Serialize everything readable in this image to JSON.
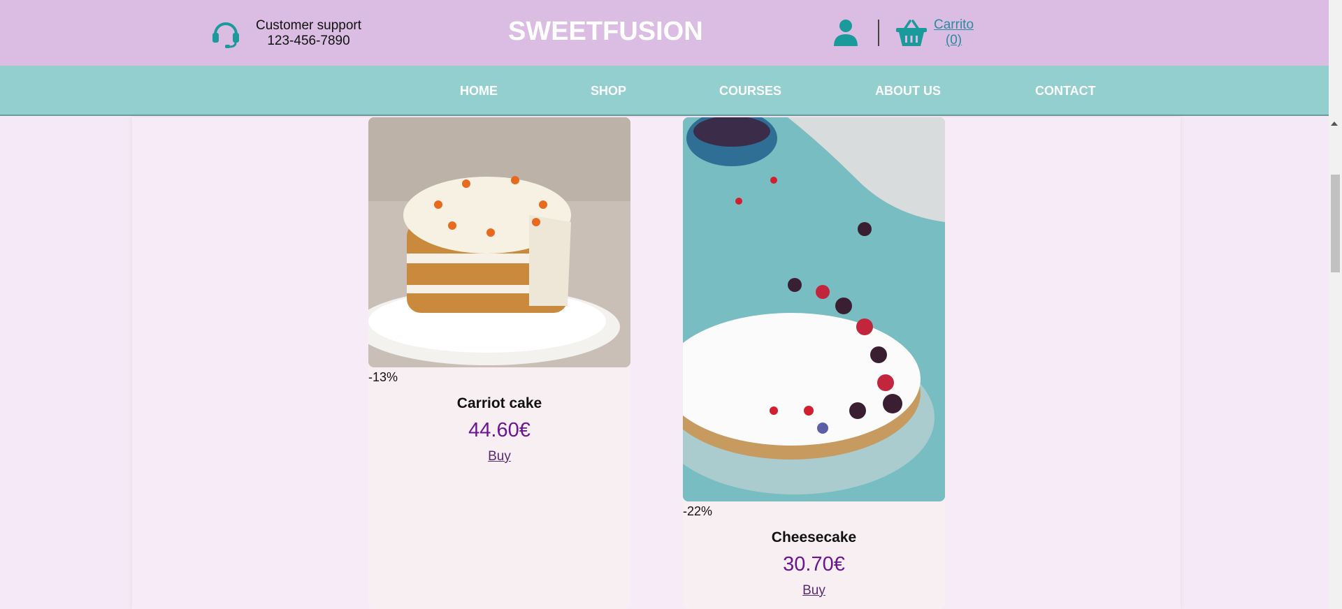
{
  "header": {
    "support_label": "Customer support",
    "support_phone": "123-456-7890",
    "brand": "SWEETFUSION",
    "cart_label": "Carrito",
    "cart_count": "(0)"
  },
  "nav": {
    "items": [
      "HOME",
      "SHOP",
      "COURSES",
      "ABOUT US",
      "CONTACT"
    ]
  },
  "products": [
    {
      "discount": "-13%",
      "name": "Carriot cake",
      "price": "44.60€",
      "buy_label": "Buy"
    },
    {
      "discount": "-22%",
      "name": "Cheesecake",
      "price": "30.70€",
      "buy_label": "Buy"
    }
  ],
  "colors": {
    "header_bg": "#dbbde3",
    "nav_bg": "#93cfcf",
    "accent_teal": "#1a9a9a",
    "price_purple": "#6b1691",
    "page_bg": "#f5e9f7"
  },
  "icons": {
    "support": "headset-icon",
    "user": "user-icon",
    "cart": "basket-icon"
  }
}
